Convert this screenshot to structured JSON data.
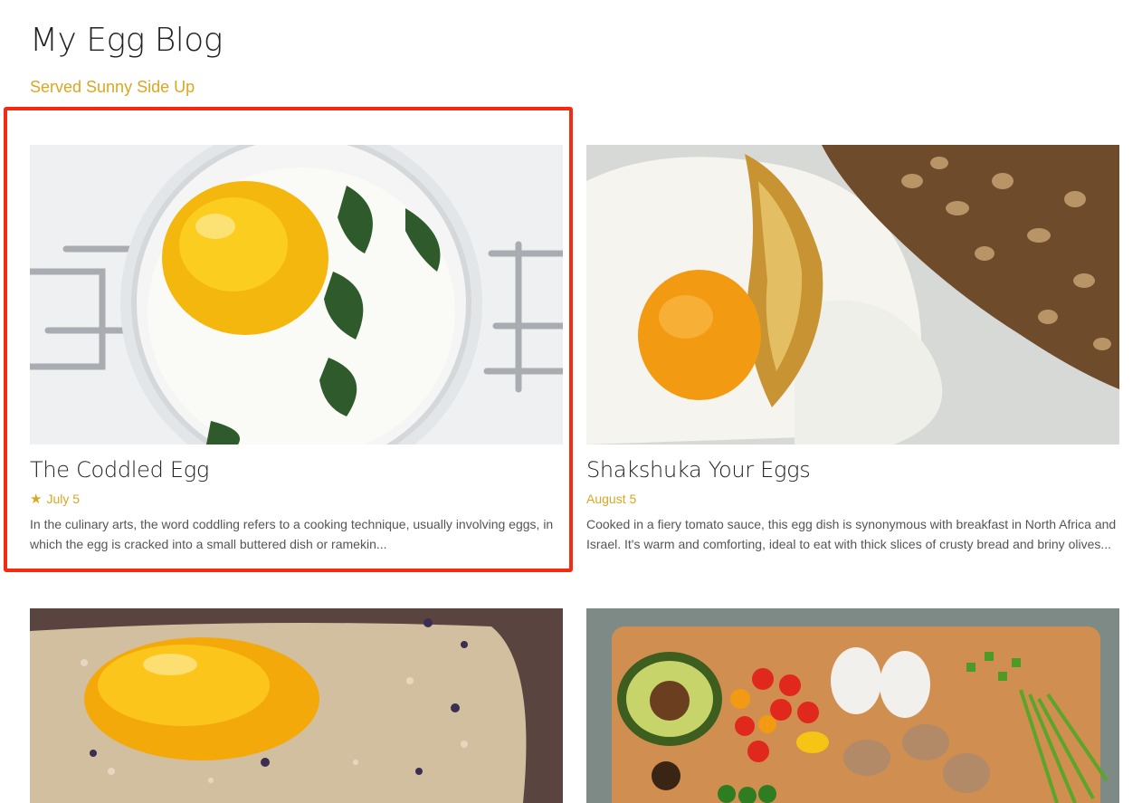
{
  "site": {
    "title": "My Egg Blog",
    "tagline": "Served Sunny Side Up"
  },
  "posts": [
    {
      "title": "The Coddled Egg",
      "date": "July 5",
      "starred": true,
      "excerpt": "In the culinary arts, the word coddling refers to a cooking technique, usually involving eggs, in which the egg is cracked into a small buttered dish or ramekin...",
      "image_icon": "coddled-egg-jar-image"
    },
    {
      "title": "Shakshuka Your Eggs",
      "date": "August 5",
      "starred": false,
      "excerpt": "Cooked in a fiery tomato sauce, this egg dish is synonymous with breakfast in North Africa and Israel. It's warm and comforting, ideal to eat with thick slices of crusty bread and briny olives...",
      "image_icon": "fried-egg-bread-image"
    },
    {
      "title": "",
      "date": "",
      "excerpt": "",
      "image_icon": "egg-yolk-on-toast-image"
    },
    {
      "title": "",
      "date": "",
      "excerpt": "",
      "image_icon": "cutting-board-vegetables-image"
    }
  ],
  "colors": {
    "accent": "#d9a722",
    "highlight": "#f52a12"
  }
}
